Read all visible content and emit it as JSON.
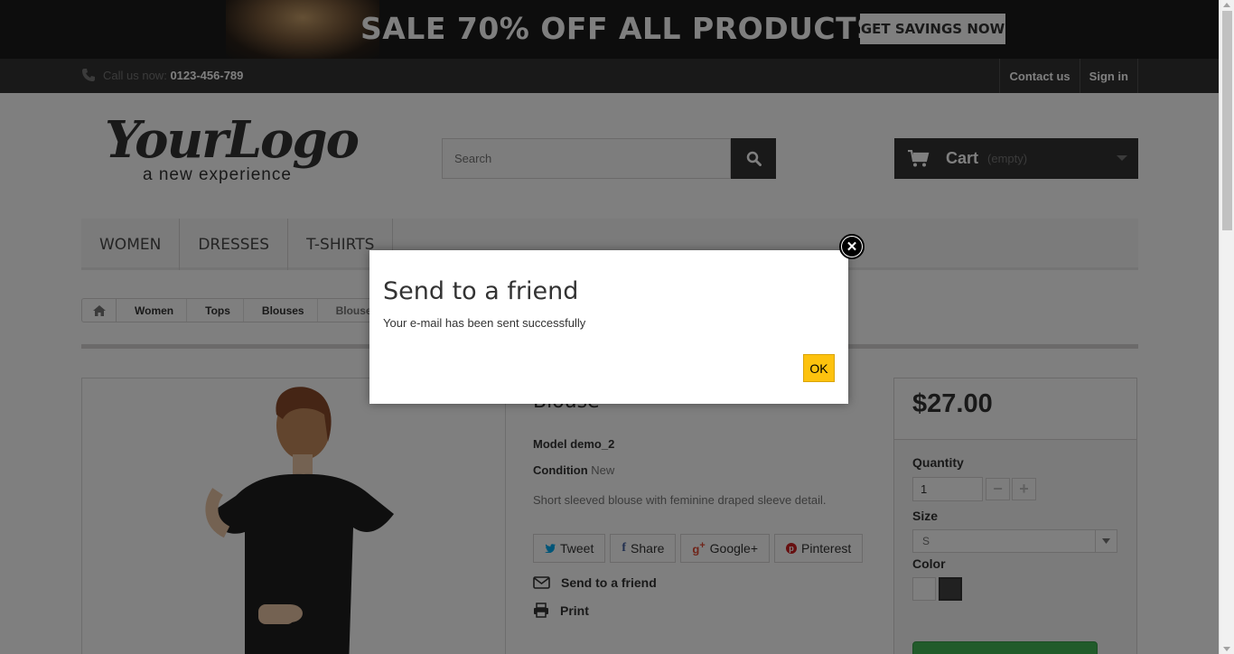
{
  "banner": {
    "headline": "SALE 70% OFF ALL PRODUCTS",
    "cta": "GET SAVINGS NOW"
  },
  "topnav": {
    "call_label": "Call us now:",
    "phone": "0123-456-789",
    "links": [
      "Contact us",
      "Sign in"
    ]
  },
  "header": {
    "logo_main": "YourLogo",
    "logo_tagline": "a new experience",
    "search_placeholder": "Search",
    "cart_label": "Cart",
    "cart_status": "(empty)"
  },
  "menu": [
    "WOMEN",
    "DRESSES",
    "T-SHIRTS"
  ],
  "breadcrumb": [
    "Women",
    "Tops",
    "Blouses",
    "Blouse"
  ],
  "product": {
    "name": "Blouse",
    "model_label": "Model",
    "model": "demo_2",
    "condition_label": "Condition",
    "condition": "New",
    "description": "Short sleeved blouse with feminine draped sleeve detail.",
    "social": [
      "Tweet",
      "Share",
      "Google+",
      "Pinterest"
    ],
    "send_friend": "Send to a friend",
    "print": "Print"
  },
  "buy": {
    "price": "$27.00",
    "quantity_label": "Quantity",
    "quantity": "1",
    "size_label": "Size",
    "size": "S",
    "color_label": "Color",
    "colors": [
      "#ffffff",
      "#434343"
    ]
  },
  "modal": {
    "title": "Send to a friend",
    "message": "Your e-mail has been sent successfully",
    "ok": "OK"
  }
}
